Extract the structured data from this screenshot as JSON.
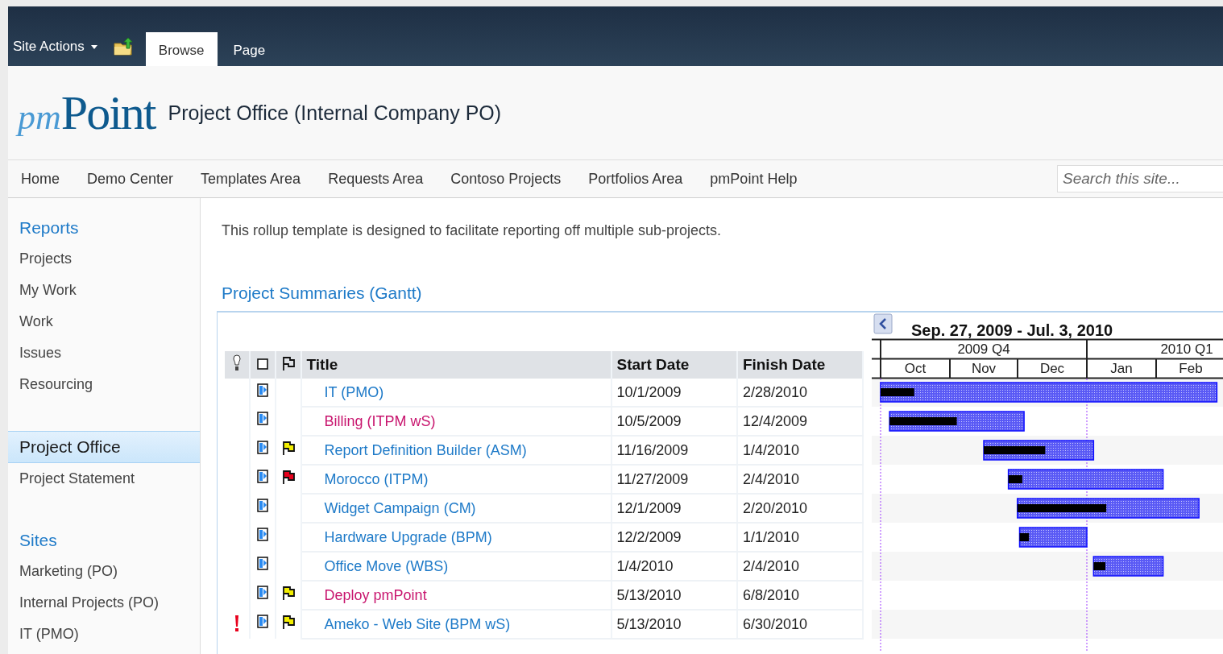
{
  "ribbon": {
    "site_actions": "Site Actions",
    "tabs": [
      {
        "label": "Browse",
        "selected": true
      },
      {
        "label": "Page",
        "selected": false
      }
    ]
  },
  "header": {
    "logo": {
      "lead": "pm",
      "rest": "Point"
    },
    "site_title": "Project Office (Internal Company PO)"
  },
  "top_nav": {
    "items": [
      "Home",
      "Demo Center",
      "Templates Area",
      "Requests Area",
      "Contoso Projects",
      "Portfolios Area",
      "pmPoint Help"
    ],
    "search": {
      "placeholder": "Search this site..."
    }
  },
  "sidebar": {
    "items": [
      {
        "kind": "heading",
        "label": "Reports",
        "selected": false
      },
      {
        "kind": "link",
        "label": "Projects",
        "selected": false
      },
      {
        "kind": "link",
        "label": "My Work",
        "selected": false
      },
      {
        "kind": "link",
        "label": "Work",
        "selected": false
      },
      {
        "kind": "link",
        "label": "Issues",
        "selected": false
      },
      {
        "kind": "link",
        "label": "Resourcing",
        "selected": false
      },
      {
        "kind": "spacer"
      },
      {
        "kind": "heading",
        "label": "Project Office",
        "selected": true
      },
      {
        "kind": "link",
        "label": "Project Statement",
        "selected": false
      },
      {
        "kind": "spacer"
      },
      {
        "kind": "heading",
        "label": "Sites",
        "selected": false
      },
      {
        "kind": "link",
        "label": "Marketing (PO)",
        "selected": false
      },
      {
        "kind": "link",
        "label": "Internal Projects (PO)",
        "selected": false
      },
      {
        "kind": "link",
        "label": "IT (PMO)",
        "selected": false
      }
    ]
  },
  "content": {
    "description": "This rollup template is designed to facilitate reporting off multiple sub-projects.",
    "section_title": "Project Summaries (Gantt)",
    "table": {
      "columns": [
        "Title",
        "Start Date",
        "Finish Date"
      ],
      "rows": [
        {
          "alert": false,
          "title": "IT (PMO)",
          "color": "#1e7ac8",
          "start_date": "10/1/2009",
          "finish_date": "2/28/2010",
          "level": 0.1
        },
        {
          "alert": false,
          "title": "Billing (ITPM wS)",
          "color": "#c8156e",
          "start_date": "10/5/2009",
          "finish_date": "12/4/2009",
          "level": 0.5
        },
        {
          "alert": false,
          "flag": {
            "color": "#f2ee00"
          },
          "title": "Report Definition Builder (ASM)",
          "color": "#1e7ac8",
          "start_date": "11/16/2009",
          "finish_date": "1/4/2010",
          "level": 0.56
        },
        {
          "alert": false,
          "flag": {
            "color": "#e8001c"
          },
          "title": "Morocco (ITPM)",
          "color": "#1e7ac8",
          "start_date": "11/27/2009",
          "finish_date": "2/4/2010",
          "level": 0.09
        },
        {
          "alert": false,
          "title": "Widget Campaign (CM)",
          "color": "#1e7ac8",
          "start_date": "12/1/2009",
          "finish_date": "2/20/2010",
          "level": 0.49
        },
        {
          "alert": false,
          "title": "Hardware Upgrade (BPM)",
          "color": "#1e7ac8",
          "start_date": "12/2/2009",
          "finish_date": "1/1/2010",
          "level": 0.14
        },
        {
          "alert": false,
          "title": "Office Move (WBS)",
          "color": "#1e7ac8",
          "start_date": "1/4/2010",
          "finish_date": "2/4/2010",
          "level": 0.17
        },
        {
          "alert": false,
          "flag": {
            "color": "#f2ee00"
          },
          "title": "Deploy pmPoint",
          "color": "#c8156e",
          "start_date": "5/13/2010",
          "finish_date": "6/8/2010"
        },
        {
          "alert": true,
          "flag": {
            "color": "#f2ee00"
          },
          "title": "Ameko - Web Site (BPM wS)",
          "color": "#1e7ac8",
          "start_date": "5/13/2010",
          "finish_date": "6/30/2010"
        }
      ]
    },
    "gantt": {
      "range": "Sep. 27, 2009 - Jul. 3, 2010",
      "quarters": [
        "2009 Q4",
        "2010 Q1"
      ],
      "months": [
        "Oct",
        "Nov",
        "Dec",
        "Jan",
        "Feb"
      ]
    }
  }
}
